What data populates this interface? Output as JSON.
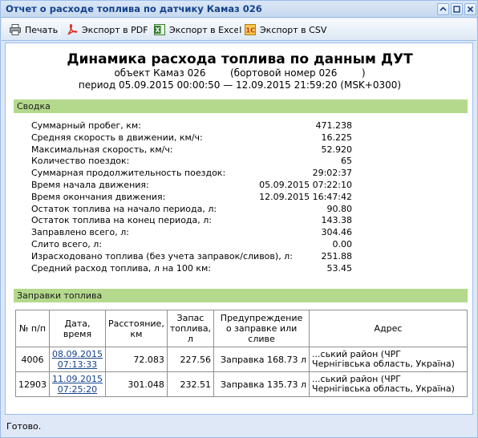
{
  "window": {
    "title": "Отчет о расходе топлива по датчику Камаз 026",
    "controls": [
      "collapse",
      "maximize",
      "close"
    ]
  },
  "toolbar": {
    "print_label": "Печать",
    "pdf_label": "Экспорт в PDF",
    "excel_label": "Экспорт в Excel",
    "csv_label": "Экспорт в CSV"
  },
  "report": {
    "title": "Динамика расхода топлива по данным ДУТ",
    "object_line": "объект Камаз 026        (бортовой номер 026        )",
    "period_line": "период 05.09.2015 00:00:50 — 12.09.2015 21:59:20 (MSK+0300)"
  },
  "summary": {
    "header": "Сводка",
    "rows": [
      {
        "label": "Суммарный пробег, км:",
        "value": "471.238"
      },
      {
        "label": "Средняя скорость в движении, км/ч:",
        "value": "16.225"
      },
      {
        "label": "Максимальная скорость, км/ч:",
        "value": "52.920"
      },
      {
        "label": "Количество поездок:",
        "value": "65"
      },
      {
        "label": "Суммарная продолжительность поездок:",
        "value": "29:02:37"
      },
      {
        "label": "Время начала движения:",
        "value": "05.09.2015 07:22:10"
      },
      {
        "label": "Время окончания движения:",
        "value": "12.09.2015 16:47:42"
      },
      {
        "label": "Остаток топлива на начало периода, л:",
        "value": "90.80"
      },
      {
        "label": "Остаток топлива на конец периода, л:",
        "value": "143.38"
      },
      {
        "label": "Заправлено всего, л:",
        "value": "304.46"
      },
      {
        "label": "Слито всего, л:",
        "value": "0.00"
      },
      {
        "label": "Израсходовано топлива (без учета заправок/сливов), л:",
        "value": "251.88"
      },
      {
        "label": "Средний расход топлива, л на 100 км:",
        "value": "53.45"
      }
    ]
  },
  "refuels": {
    "header": "Заправки топлива",
    "columns": [
      "№ п/п",
      "Дата, время",
      "Расстояние, км",
      "Запас топлива, л",
      "Предупреждение о заправке или сливе",
      "Адрес"
    ],
    "rows": [
      {
        "num": "4006",
        "date": "08.09.2015",
        "time": "07:13:33",
        "distance": "72.083",
        "fuel": "227.56",
        "warning": "Заправка 168.73 л",
        "address1": "...ський район (ЧРГ",
        "address2": "Чернігівська область, Україна)"
      },
      {
        "num": "12903",
        "date": "11.09.2015",
        "time": "07:25:20",
        "distance": "301.048",
        "fuel": "232.51",
        "warning": "Заправка 135.73 л",
        "address1": "...ський район (ЧРГ",
        "address2": "Чернігівська область, Україна)"
      }
    ]
  },
  "status": {
    "text": "Готово."
  }
}
